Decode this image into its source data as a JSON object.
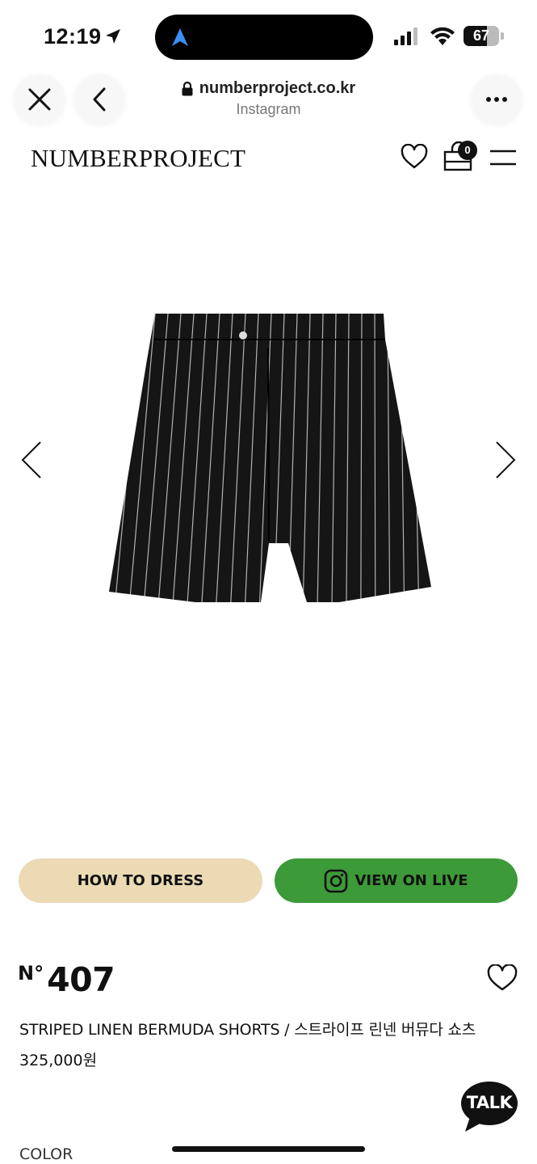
{
  "status_bar": {
    "time": "12:19",
    "battery_level": "67",
    "battery_fraction": 0.67,
    "icons": [
      "location-arrow-icon",
      "navigation-icon",
      "cellular-signal-icon",
      "wifi-icon",
      "battery-icon"
    ]
  },
  "browser": {
    "url": "numberproject.co.kr",
    "source": "Instagram",
    "icons": [
      "close-icon",
      "back-chevron-icon",
      "lock-icon",
      "more-icon"
    ]
  },
  "header": {
    "logo": "NUMBERPROJECT",
    "cart_count": "0",
    "icons": [
      "heart-icon",
      "cart-icon",
      "menu-icon"
    ]
  },
  "product": {
    "number_prefix": "N°",
    "number": "407",
    "name": "STRIPED LINEN BERMUDA SHORTS / 스트라이프 린넨 버뮤다 쇼츠",
    "price": "325,000원",
    "image_subject": "black pinstripe bermuda shorts"
  },
  "actions": {
    "how_to_dress": "HOW TO DRESS",
    "view_on_live": "VIEW ON LIVE"
  },
  "chat": {
    "label": "TALK"
  },
  "options": {
    "color_label": "COLOR"
  },
  "colors": {
    "how_to_dress_bg": "#ecdab5",
    "view_on_live_bg": "#3c9a38",
    "text": "#111111",
    "shorts": "#151515",
    "stripe": "#cfcfcf"
  }
}
